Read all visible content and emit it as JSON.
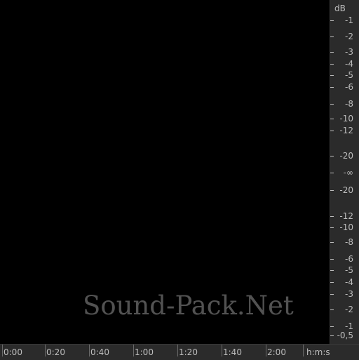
{
  "waveform": {
    "color": "#3d8bff",
    "background": "#000000",
    "watermark": "Sound-Pack.Net"
  },
  "db_ruler": {
    "unit": "dB",
    "labels": [
      "-1",
      "-2",
      "-3",
      "-4",
      "-5",
      "-6",
      "-8",
      "-10",
      "-12",
      "-20",
      "-∞",
      "-20",
      "-12",
      "-10",
      "-8",
      "-6",
      "-5",
      "-4",
      "-3",
      "-2",
      "-1",
      "-0,5"
    ]
  },
  "time_ruler": {
    "unit": "h:m:s",
    "labels": [
      "0:00",
      "0:20",
      "0:40",
      "1:00",
      "1:20",
      "1:40",
      "2:00"
    ]
  }
}
